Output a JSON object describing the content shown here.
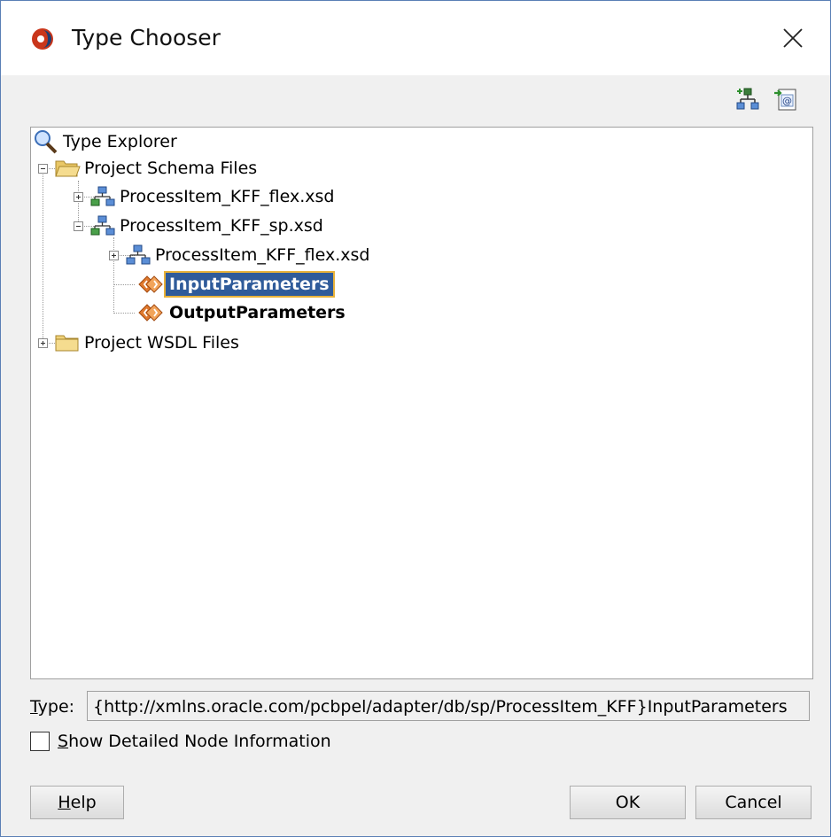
{
  "window": {
    "title": "Type Chooser",
    "app_icon": "oracle-jdeveloper-icon",
    "close_icon": "close-icon"
  },
  "toolbar": {
    "icons": [
      "new-schema-icon",
      "import-schema-icon"
    ]
  },
  "tree": {
    "root": {
      "label": "Type Explorer",
      "icon": "magnifier-icon"
    },
    "items": [
      {
        "label": "Project Schema Files",
        "icon": "open-folder-icon",
        "expanded": true
      },
      {
        "label": "ProcessItem_KFF_flex.xsd",
        "icon": "schema-icon",
        "expanded": false
      },
      {
        "label": "ProcessItem_KFF_sp.xsd",
        "icon": "schema-icon",
        "expanded": true
      },
      {
        "label": "ProcessItem_KFF_flex.xsd",
        "icon": "schema-icon",
        "expanded": false
      },
      {
        "label": "InputParameters",
        "icon": "element-icon",
        "selected": true
      },
      {
        "label": "OutputParameters",
        "icon": "element-icon"
      },
      {
        "label": "Project WSDL Files",
        "icon": "folder-icon",
        "expanded": false
      }
    ]
  },
  "type_field": {
    "label_mnemonic": "T",
    "label_rest": "ype:",
    "value": "{http://xmlns.oracle.com/pcbpel/adapter/db/sp/ProcessItem_KFF}InputParameters"
  },
  "show_detail": {
    "checked": false,
    "label_mnemonic": "S",
    "label_rest": "how Detailed Node Information"
  },
  "buttons": {
    "help_mnemonic": "H",
    "help_rest": "elp",
    "ok": "OK",
    "cancel": "Cancel"
  },
  "colors": {
    "selection": "#2f5b9a",
    "selection_border": "#e8b23a",
    "window_border": "#5a7fb5"
  }
}
